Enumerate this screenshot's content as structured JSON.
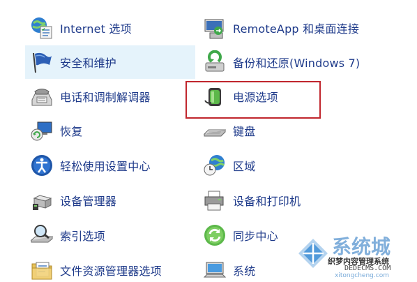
{
  "items": [
    {
      "id": "internet-options",
      "label": "Internet 选项",
      "icon": "internet-options-icon"
    },
    {
      "id": "remoteapp",
      "label": "RemoteApp 和桌面连接",
      "icon": "remoteapp-icon"
    },
    {
      "id": "security-maintenance",
      "label": "安全和维护",
      "icon": "flag-icon"
    },
    {
      "id": "backup-restore",
      "label": "备份和还原(Windows 7)",
      "icon": "backup-icon"
    },
    {
      "id": "phone-modem",
      "label": "电话和调制解调器",
      "icon": "phone-icon"
    },
    {
      "id": "power-options",
      "label": "电源选项",
      "icon": "battery-icon"
    },
    {
      "id": "recovery",
      "label": "恢复",
      "icon": "recovery-icon"
    },
    {
      "id": "keyboard",
      "label": "键盘",
      "icon": "keyboard-icon"
    },
    {
      "id": "ease-of-access",
      "label": "轻松使用设置中心",
      "icon": "accessibility-icon"
    },
    {
      "id": "region",
      "label": "区域",
      "icon": "globe-clock-icon"
    },
    {
      "id": "device-manager",
      "label": "设备管理器",
      "icon": "device-manager-icon"
    },
    {
      "id": "devices-printers",
      "label": "设备和打印机",
      "icon": "printer-icon"
    },
    {
      "id": "indexing-options",
      "label": "索引选项",
      "icon": "magnifier-icon"
    },
    {
      "id": "sync-center",
      "label": "同步中心",
      "icon": "sync-icon"
    },
    {
      "id": "file-explorer-options",
      "label": "文件资源管理器选项",
      "icon": "folder-options-icon"
    },
    {
      "id": "system",
      "label": "系统",
      "icon": "computer-icon"
    }
  ],
  "colors": {
    "label": "#1e3a8a",
    "hover_bg": "#e5f3fb",
    "highlight_border": "#c0262d"
  },
  "watermark": {
    "title": "系统城",
    "subtitle": "织梦内容管理系统",
    "site": "DEDECMS.COM",
    "url": "xitongcheng.com"
  }
}
